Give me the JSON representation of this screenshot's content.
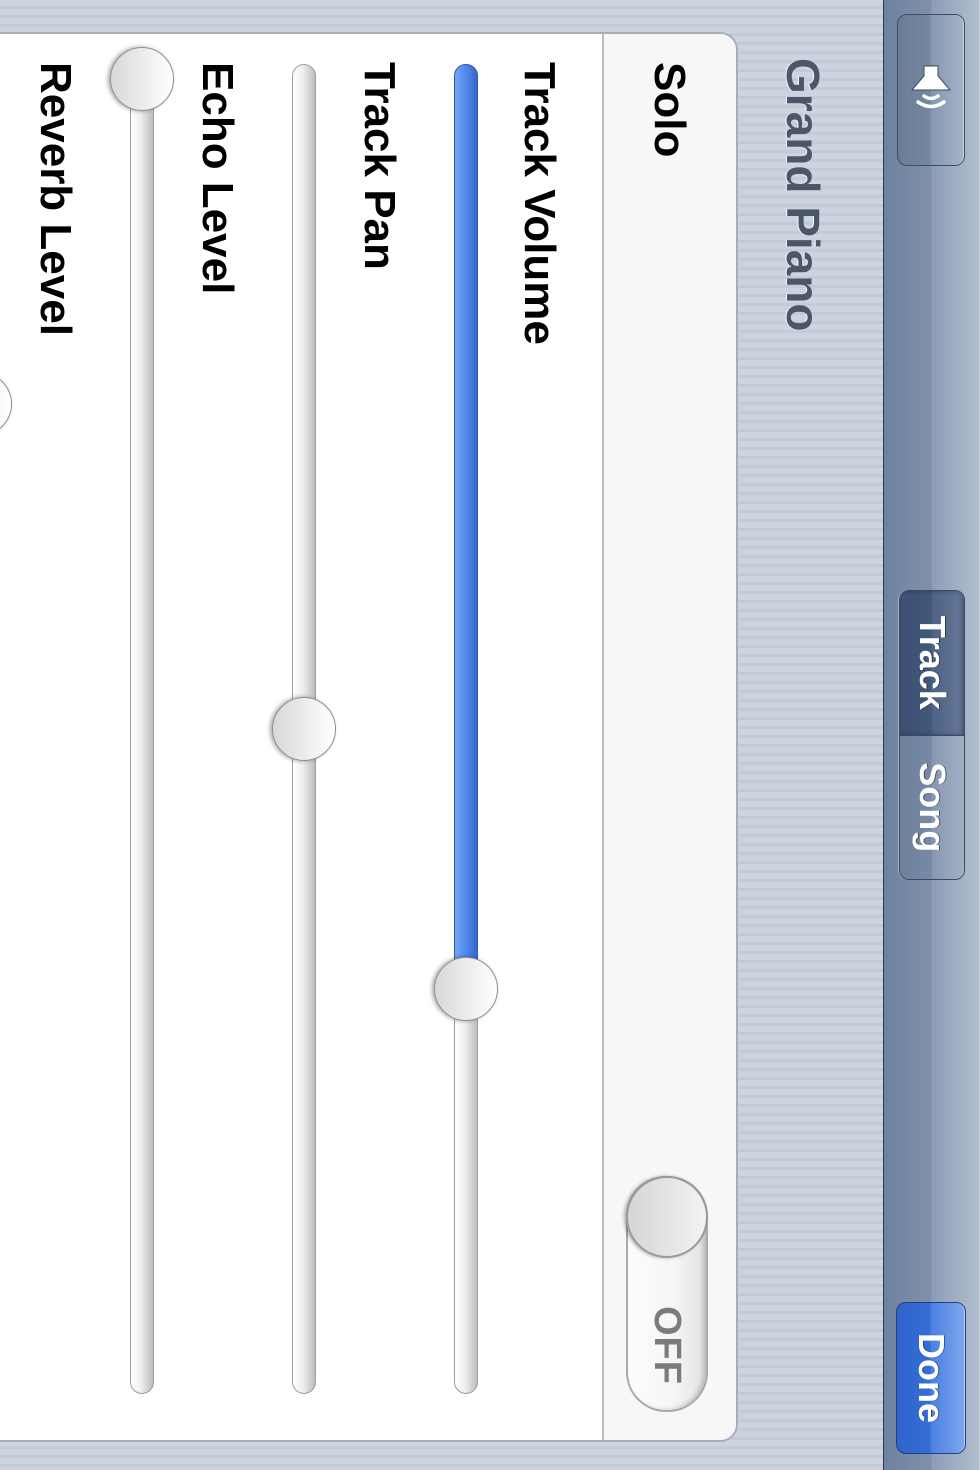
{
  "navbar": {
    "speaker_icon": "speaker-wave-icon",
    "segments": [
      {
        "label": "Track",
        "selected": true
      },
      {
        "label": "Song",
        "selected": false
      }
    ],
    "done_label": "Done"
  },
  "track": {
    "title": "Grand Piano"
  },
  "solo": {
    "label": "Solo",
    "toggle_text": "OFF",
    "value": false
  },
  "sliders": {
    "volume": {
      "label": "Track Volume",
      "value": 0.7,
      "filled": true,
      "accent": "#4a80e4"
    },
    "pan": {
      "label": "Track Pan",
      "value": 0.5,
      "filled": false
    },
    "echo": {
      "label": "Echo Level",
      "value": 0.0,
      "filled": false
    },
    "reverb": {
      "label": "Reverb Level",
      "value": 0.25,
      "filled": false
    }
  },
  "colors": {
    "done_button": "#356ed6",
    "segment_active": "#42587b"
  }
}
